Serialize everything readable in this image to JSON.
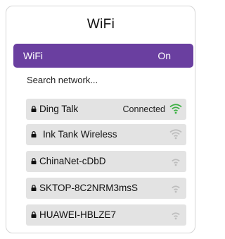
{
  "header": {
    "title": "WiFi"
  },
  "wifi_toggle": {
    "label": "WiFi",
    "state": "On"
  },
  "search": {
    "label": "Search network..."
  },
  "networks": [
    {
      "name": "Ding Talk",
      "status": "Connected",
      "signal_icon": "wifi-signal-full-icon",
      "signal_color": "#3cb043"
    },
    {
      "name": "Ink Tank Wireless",
      "status": "",
      "signal_icon": "wifi-signal-icon",
      "signal_color": "#bdbdbd"
    },
    {
      "name": "ChinaNet-cDbD",
      "status": "",
      "signal_icon": "wifi-signal-icon",
      "signal_color": "#bdbdbd"
    },
    {
      "name": "SKTOP-8C2NRM3msS",
      "status": "",
      "signal_icon": "wifi-signal-icon",
      "signal_color": "#bdbdbd"
    },
    {
      "name": "HUAWEI-HBLZE7",
      "status": "",
      "signal_icon": "wifi-signal-icon",
      "signal_color": "#bdbdbd"
    }
  ],
  "colors": {
    "accent": "#6a3fa0",
    "row_bg": "#e3e3e3"
  }
}
